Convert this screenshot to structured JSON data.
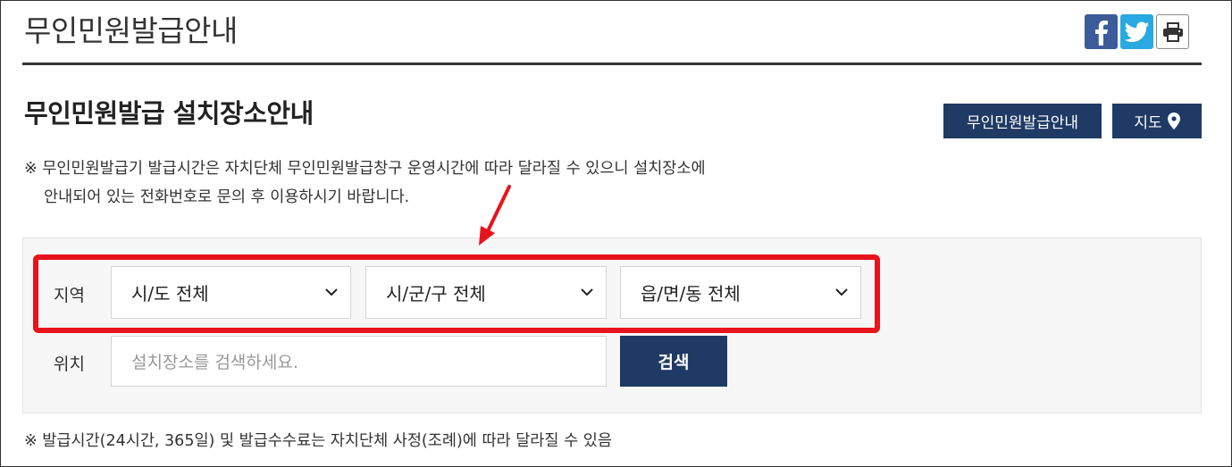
{
  "header": {
    "title": "무인민원발급안내",
    "share": [
      {
        "name": "facebook-icon",
        "color": "#3b5b9b"
      },
      {
        "name": "twitter-icon",
        "color": "#29a9e1"
      },
      {
        "name": "print-icon",
        "color": "#333333"
      }
    ]
  },
  "section": {
    "title": "무인민원발급 설치장소안내",
    "guide_button": "무인민원발급안내",
    "map_button": "지도",
    "map_icon": "map-pin-icon"
  },
  "notice": {
    "line1": "※ 무인민원발급기 발급시간은 자치단체 무인민원발급창구 운영시간에 따라 달라질 수 있으니 설치장소에",
    "line2": "안내되어 있는 전화번호로 문의 후 이용하시기 바랍니다."
  },
  "search": {
    "region_label": "지역",
    "location_label": "위치",
    "selects": [
      {
        "value": "시/도 전체"
      },
      {
        "value": "시/군/구 전체"
      },
      {
        "value": "읍/면/동 전체"
      }
    ],
    "input_placeholder": "설치장소를 검색하세요.",
    "search_button": "검색"
  },
  "footnote": "※ 발급시간(24시간, 365일) 및 발급수수료는 자치단체 사정(조례)에 따라 달라질 수 있음",
  "colors": {
    "accent": "#1f3a64",
    "highlight": "#e8141b"
  }
}
